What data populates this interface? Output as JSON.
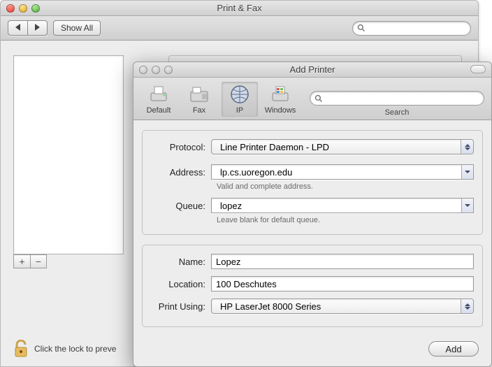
{
  "back": {
    "title": "Print & Fax",
    "showall_label": "Show All",
    "plus": "+",
    "minus": "−",
    "lock_text": "Click the lock to preve",
    "search_placeholder": ""
  },
  "front": {
    "title": "Add Printer",
    "search_placeholder": "",
    "search_label": "Search",
    "toolbar": [
      {
        "key": "default",
        "label": "Default"
      },
      {
        "key": "fax",
        "label": "Fax"
      },
      {
        "key": "ip",
        "label": "IP"
      },
      {
        "key": "windows",
        "label": "Windows"
      }
    ],
    "selected_tool": "ip",
    "labels": {
      "protocol": "Protocol:",
      "address": "Address:",
      "queue": "Queue:",
      "name": "Name:",
      "location": "Location:",
      "print_using": "Print Using:"
    },
    "values": {
      "protocol": "Line Printer Daemon - LPD",
      "address": "lp.cs.uoregon.edu",
      "queue": "lopez",
      "name": "Lopez",
      "location": "100 Deschutes",
      "print_using": "HP LaserJet 8000 Series"
    },
    "hints": {
      "address": "Valid and complete address.",
      "queue": "Leave blank for default queue."
    },
    "add_button": "Add"
  }
}
